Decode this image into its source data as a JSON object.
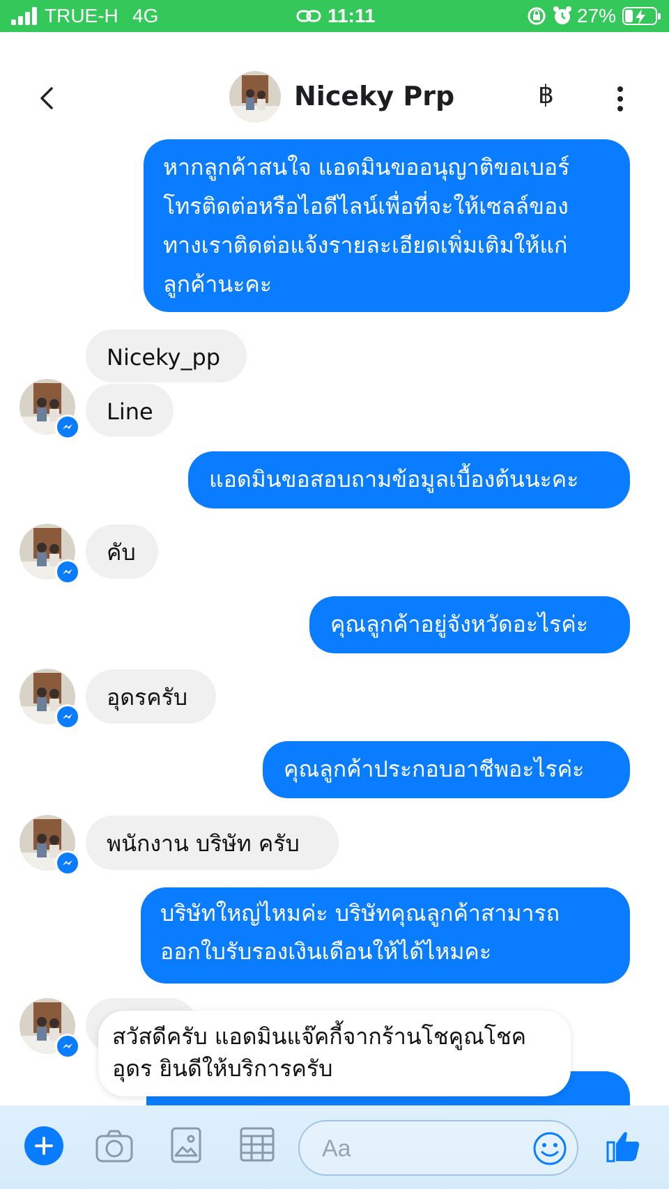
{
  "status_bar": {
    "carrier": "TRUE-H",
    "network": "4G",
    "time": "11:11",
    "battery": "27%",
    "battery_level": 0.27,
    "icons": [
      "signal-icon",
      "link-icon",
      "rotation-lock-icon",
      "alarm-icon",
      "battery-charging-icon"
    ]
  },
  "header": {
    "title": "Niceky Prp",
    "icons": [
      "back-icon",
      "baht-icon",
      "more-icon"
    ],
    "baht_symbol": "฿"
  },
  "messages": [
    {
      "from": "me",
      "text": "หากลูกค้าสนใจ แอดมินขออนุญาติขอเบอร์\nโทรติดต่อหรือไอดีไลน์เพื่อที่จะให้เซลล์ของ\nทางเราติดต่อแจ้งรายละเอียดเพิ่มเติมให้แก่\nลูกค้านะคะ"
    },
    {
      "from": "them",
      "text": "Niceky_pp"
    },
    {
      "from": "them",
      "text": "Line"
    },
    {
      "from": "me",
      "text": "แอดมินขอสอบถามข้อมูลเบื้องต้นนะคะ"
    },
    {
      "from": "them",
      "text": "คับ"
    },
    {
      "from": "me",
      "text": "คุณลูกค้าอยู่จังหวัดอะไรค่ะ"
    },
    {
      "from": "them",
      "text": "อุดรครับ"
    },
    {
      "from": "me",
      "text": "คุณลูกค้าประกอบอาชีพอะไรค่ะ"
    },
    {
      "from": "them",
      "text": "พนักงาน บริษัท ครับ"
    },
    {
      "from": "me",
      "text": "บริษัทใหญ่ไหมค่ะ  บริษัทคุณลูกค้าสามารถ\nออกใบรับรองเงินเดือนให้ได้ไหมคะ"
    }
  ],
  "notification": {
    "text": "สวัสดีครับ แอดมินแจ๊คกี้จากร้านโชคูณโชค\nอุดร ยินดีให้บริการครับ"
  },
  "composer": {
    "placeholder": "Aa",
    "value": "",
    "icons": [
      "plus-icon",
      "camera-icon",
      "image-icon",
      "calendar-icon",
      "emoji-icon",
      "thumbs-up-icon"
    ]
  },
  "colors": {
    "status_bar": "#34c759",
    "outgoing_bubble": "#0a7cff",
    "incoming_bubble": "#f0f0f0",
    "composer_bg": "#d6ebfa"
  }
}
